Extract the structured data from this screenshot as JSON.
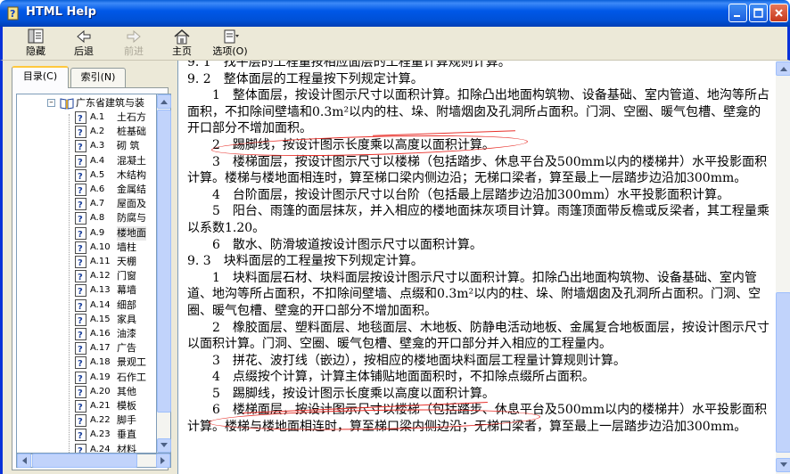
{
  "window": {
    "title": "HTML Help",
    "controls": [
      "minimize",
      "maximize",
      "close"
    ]
  },
  "toolbar": {
    "buttons": [
      {
        "label": "隐藏",
        "icon": "hide-icon",
        "enabled": true
      },
      {
        "label": "后退",
        "icon": "back-arrow-icon",
        "enabled": true
      },
      {
        "label": "前进",
        "icon": "forward-arrow-icon",
        "enabled": false
      },
      {
        "label": "主页",
        "icon": "home-icon",
        "enabled": true
      },
      {
        "label": "选项(O)",
        "icon": "options-icon",
        "enabled": true
      }
    ]
  },
  "nav": {
    "tabs": [
      {
        "label": "目录(C)",
        "active": true
      },
      {
        "label": "索引(N)",
        "active": false
      }
    ],
    "tree": {
      "root": "广东省建筑与装",
      "items": [
        {
          "code": "A.1",
          "label": "土石方"
        },
        {
          "code": "A.2",
          "label": "桩基础"
        },
        {
          "code": "A.3",
          "label": "砌 筑"
        },
        {
          "code": "A.4",
          "label": "混凝土"
        },
        {
          "code": "A.5",
          "label": "木结构"
        },
        {
          "code": "A.6",
          "label": "金属结"
        },
        {
          "code": "A.7",
          "label": "屋面及"
        },
        {
          "code": "A.8",
          "label": "防腐与"
        },
        {
          "code": "A.9",
          "label": "楼地面",
          "selected": true
        },
        {
          "code": "A.10",
          "label": "墙柱"
        },
        {
          "code": "A.11",
          "label": "天棚"
        },
        {
          "code": "A.12",
          "label": "门窗"
        },
        {
          "code": "A.13",
          "label": "幕墙"
        },
        {
          "code": "A.14",
          "label": "细部"
        },
        {
          "code": "A.15",
          "label": "家具"
        },
        {
          "code": "A.16",
          "label": "油漆"
        },
        {
          "code": "A.17",
          "label": "广告"
        },
        {
          "code": "A.18",
          "label": "景观工"
        },
        {
          "code": "A.19",
          "label": "石作工"
        },
        {
          "code": "A.20",
          "label": "其他"
        },
        {
          "code": "A.21",
          "label": "模板"
        },
        {
          "code": "A.22",
          "label": "脚手"
        },
        {
          "code": "A.23",
          "label": "垂直"
        },
        {
          "code": "A.24",
          "label": "材料"
        }
      ]
    }
  },
  "content": {
    "lines": [
      {
        "text": "9. 1　找平层的工程量按相应面层的工程量计算规则计算。",
        "indent": false
      },
      {
        "text": "9. 2　整体面层的工程量按下列规定计算。",
        "indent": false
      },
      {
        "text": "1　整体面层，按设计图示尺寸以面积计算。扣除凸出地面构筑物、设备基础、室内管道、地沟等所占面积，不扣除间壁墙和0.3m²以内的柱、垛、附墙烟囱及孔洞所占面积。门洞、空圈、暖气包槽、壁龛的开口部分不增加面积。",
        "indent": true
      },
      {
        "text": "2　踢脚线，按设计图示长度乘以高度以面积计算。",
        "indent": true
      },
      {
        "text": "3　楼梯面层，按设计图示尺寸以楼梯（包括踏步、休息平台及500mm以内的楼梯井）水平投影面积计算。楼梯与楼地面相连时，算至梯口梁内侧边沿；无梯口梁者，算至最上一层踏步边沿加300mm。",
        "indent": true
      },
      {
        "text": "4　台阶面层，按设计图示尺寸以台阶（包括最上层踏步边沿加300mm）水平投影面积计算。",
        "indent": true
      },
      {
        "text": "5　阳台、雨篷的面层抹灰，并入相应的楼地面抹灰项目计算。雨篷顶面带反檐或反梁者，其工程量乘以系数1.20。",
        "indent": true
      },
      {
        "text": "6　散水、防滑坡道按设计图示尺寸以面积计算。",
        "indent": true
      },
      {
        "text": "9. 3　块料面层的工程量按下列规定计算。",
        "indent": false
      },
      {
        "text": "1　块料面层石材、块料面层按设计图示尺寸以面积计算。扣除凸出地面构筑物、设备基础、室内管道、地沟等所占面积，不扣除间壁墙、点缀和0.3m²以内的柱、垛、附墙烟囱及孔洞所占面积。门洞、空圈、暖气包槽、壁龛的开口部分不增加面积。",
        "indent": true
      },
      {
        "text": "2　橡胶面层、塑料面层、地毯面层、木地板、防静电活动地板、金属复合地板面层，按设计图示尺寸以面积计算。门洞、空圈、暖气包槽、壁龛的开口部分并入相应的工程量内。",
        "indent": true
      },
      {
        "text": "3　拼花、波打线（嵌边），按相应的楼地面块料面层工程量计算规则计算。",
        "indent": true
      },
      {
        "text": "4　点缀按个计算，计算主体铺贴地面面积时，不扣除点缀所占面积。",
        "indent": true
      },
      {
        "text": "5　踢脚线，按设计图示长度乘以高度以面积计算。",
        "indent": true
      },
      {
        "text": "6　楼梯面层，按设计图示尺寸以楼梯（包括踏步、休息平台及500mm以内的楼梯井）水平投影面积计算。楼梯与楼地面相连时，算至梯口梁内侧边沿；无梯口梁者，算至最上一层踏步边沿加300mm。",
        "indent": true
      }
    ]
  },
  "colors": {
    "titlebar": "#0058e8",
    "frame": "#0831d9",
    "toolbar_bg": "#ece9d8",
    "annotation": "#e8302a"
  }
}
